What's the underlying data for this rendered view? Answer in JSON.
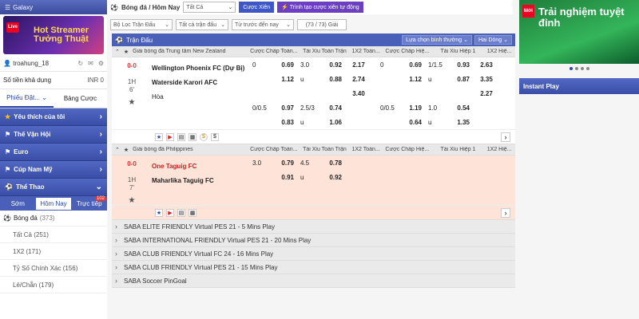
{
  "left": {
    "galaxy": "Galaxy",
    "banner_tag": "Live",
    "banner_text": "Hot Streamer Tưởng Thuật",
    "username": "troahung_18",
    "balance_label": "Số tiền khả dụng",
    "balance_value": "INR 0",
    "tab_slip": "Phiếu Đặt...",
    "tab_bets": "Bảng Cược",
    "menu": [
      "Yêu thích của tôi",
      "Thế Vận Hội",
      "Euro",
      "Cúp Nam Mỹ",
      "Thể Thao"
    ],
    "subtabs": {
      "early": "Sớm",
      "today": "Hôm Nay",
      "live": "Trực tiếp",
      "live_badge": "102"
    },
    "sport": "Bóng đá",
    "sport_count": "(373)",
    "items": [
      "Tất Cả (251)",
      "1X2 (171)",
      "Tỷ Số Chính Xác (156)",
      "Lẻ/Chẵn (179)"
    ]
  },
  "topbar": {
    "title": "Bóng đá / Hôm Nay",
    "select": "Tất Cả",
    "btn_parlay": "Cược Xiên",
    "btn_auto": "Trình tạo cược xiên tự động"
  },
  "filters": {
    "league": "Bộ Lọc Trận Đấu",
    "all": "Tất cả trận đấu",
    "time": "Từ trước đến nay",
    "count": "(73 / 73) Giải"
  },
  "section": {
    "title": "Trận Đấu",
    "sort": "Lựa chọn bình thường",
    "lines": "Hai Dòng"
  },
  "headers": {
    "hdp": "Cược Chấp Toàn...",
    "ou": "Tài Xỉu Toàn Trận",
    "x12": "1X2 Toàn...",
    "hdp1": "Cược Chấp Hiệ...",
    "ou1": "Tài Xỉu Hiệp 1",
    "x121": "1X2 Hiệ..."
  },
  "league1": {
    "name": "Giải bóng đá Trung tâm New Zealand",
    "score": "0-0",
    "period": "1H",
    "minute": "6'",
    "home": "Wellington Phoenix FC (Dự Bị)",
    "away": "Waterside Karori AFC",
    "draw": "Hòa",
    "rows": [
      [
        "0",
        "0.69",
        "3.0",
        "0.92",
        "2.17",
        "0",
        "0.69",
        "1/1.5",
        "0.93",
        "2.63"
      ],
      [
        "",
        "1.12",
        "u",
        "0.88",
        "2.74",
        "",
        "1.12",
        "u",
        "0.87",
        "3.35"
      ],
      [
        "",
        "",
        "",
        "",
        "3.40",
        "",
        "",
        "",
        "",
        "2.27"
      ],
      [
        "0/0.5",
        "0.97",
        "2.5/3",
        "0.74",
        "",
        "0/0.5",
        "1.19",
        "1.0",
        "0.54",
        ""
      ],
      [
        "",
        "0.83",
        "u",
        "1.06",
        "",
        "",
        "0.64",
        "u",
        "1.35",
        ""
      ]
    ]
  },
  "league2": {
    "name": "Giải bóng đá Philippines",
    "score": "0-0",
    "period": "1H",
    "minute": "7'",
    "home": "One Taguig FC",
    "away": "Maharlika Taguig FC",
    "rows": [
      [
        "3.0",
        "0.79",
        "4.5",
        "0.78",
        "",
        "",
        "",
        "",
        "",
        ""
      ],
      [
        "",
        "0.91",
        "u",
        "0.92",
        "",
        "",
        "",
        "",
        "",
        ""
      ]
    ]
  },
  "leagues": [
    "SABA ELITE FRIENDLY Virtual PES 21 - 5 Mins Play",
    "SABA INTERNATIONAL FRIENDLY Virtual PES 21 - 20 Mins Play",
    "SABA CLUB FRIENDLY Virtual FC 24 - 16 Mins Play",
    "SABA CLUB FRIENDLY Virtual PES 21 - 15 Mins Play",
    "SABA Soccer PinGoal"
  ],
  "right": {
    "banner_tag": "Mới",
    "banner_text": "Trải nghiệm tuyệt đỉnh",
    "instant": "Instant Play"
  }
}
